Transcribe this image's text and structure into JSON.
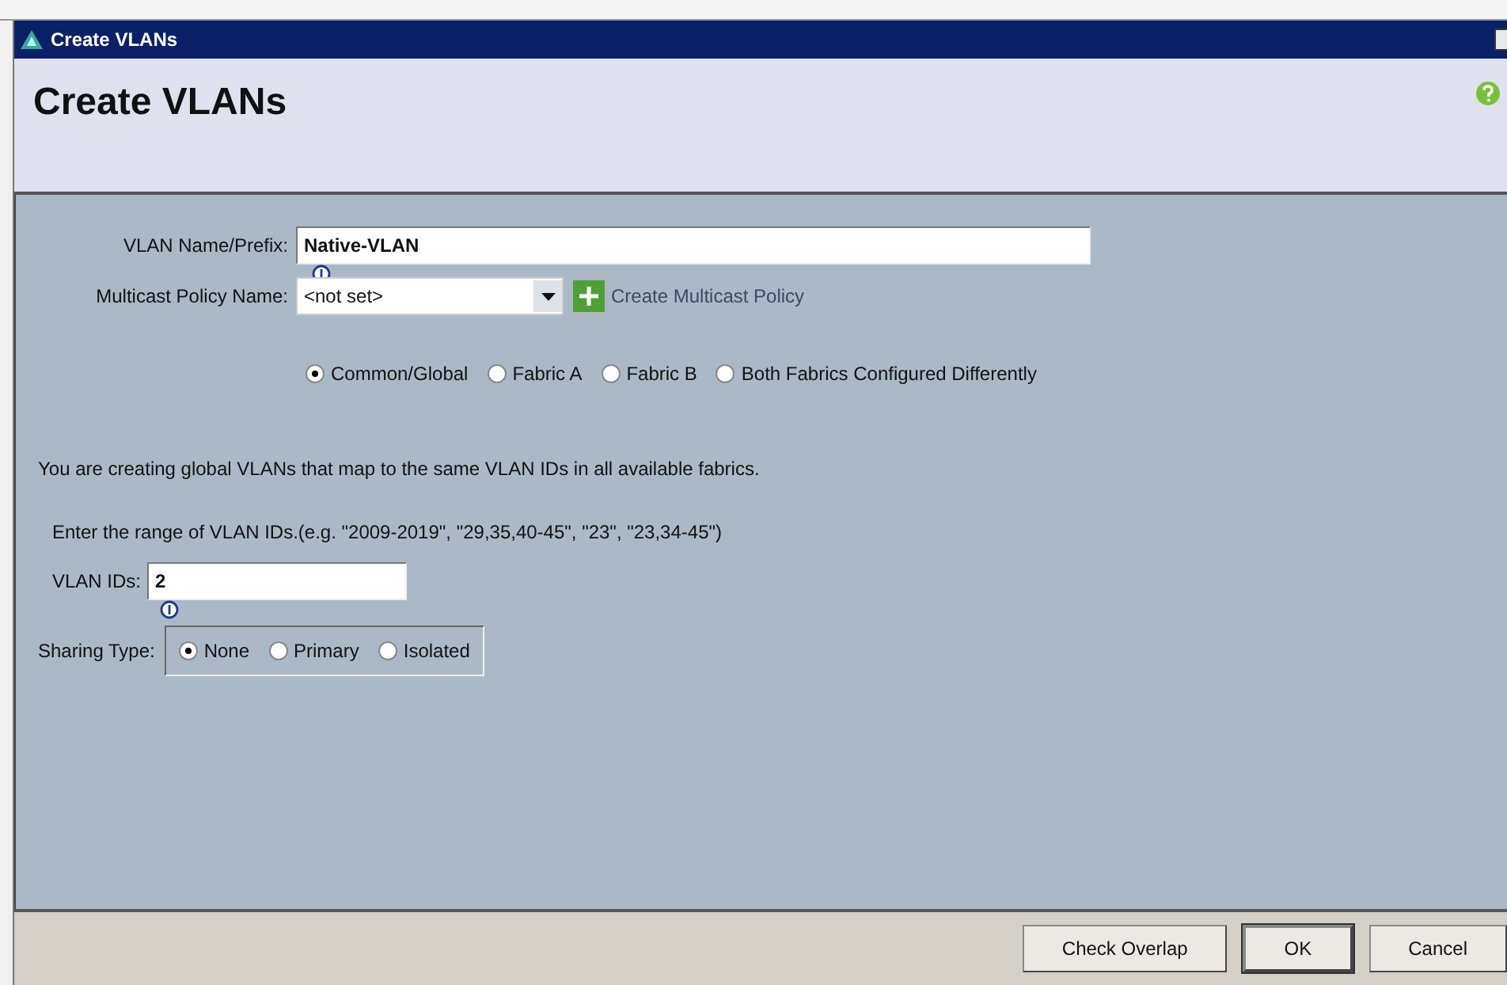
{
  "window": {
    "title": "Create VLANs"
  },
  "header": {
    "title": "Create VLANs"
  },
  "form": {
    "name_label": "VLAN Name/Prefix:",
    "name_value": "Native-VLAN",
    "multicast_label": "Multicast Policy Name:",
    "multicast_value": "<not set>",
    "create_policy_link": "Create Multicast Policy",
    "scope_options": [
      {
        "label": "Common/Global",
        "selected": true
      },
      {
        "label": "Fabric A",
        "selected": false
      },
      {
        "label": "Fabric B",
        "selected": false
      },
      {
        "label": "Both Fabrics Configured Differently",
        "selected": false
      }
    ],
    "info_text": "You are creating global VLANs that map to the same VLAN IDs in all available fabrics.",
    "range_hint": "Enter the range of VLAN IDs.(e.g. \"2009-2019\", \"29,35,40-45\", \"23\", \"23,34-45\")",
    "ids_label": "VLAN IDs:",
    "ids_value": "2",
    "sharing_label": "Sharing Type:",
    "sharing_options": [
      {
        "label": "None",
        "selected": true
      },
      {
        "label": "Primary",
        "selected": false
      },
      {
        "label": "Isolated",
        "selected": false
      }
    ]
  },
  "buttons": [
    {
      "label": "Check Overlap",
      "default": false
    },
    {
      "label": "OK",
      "default": true
    },
    {
      "label": "Cancel",
      "default": false
    }
  ]
}
